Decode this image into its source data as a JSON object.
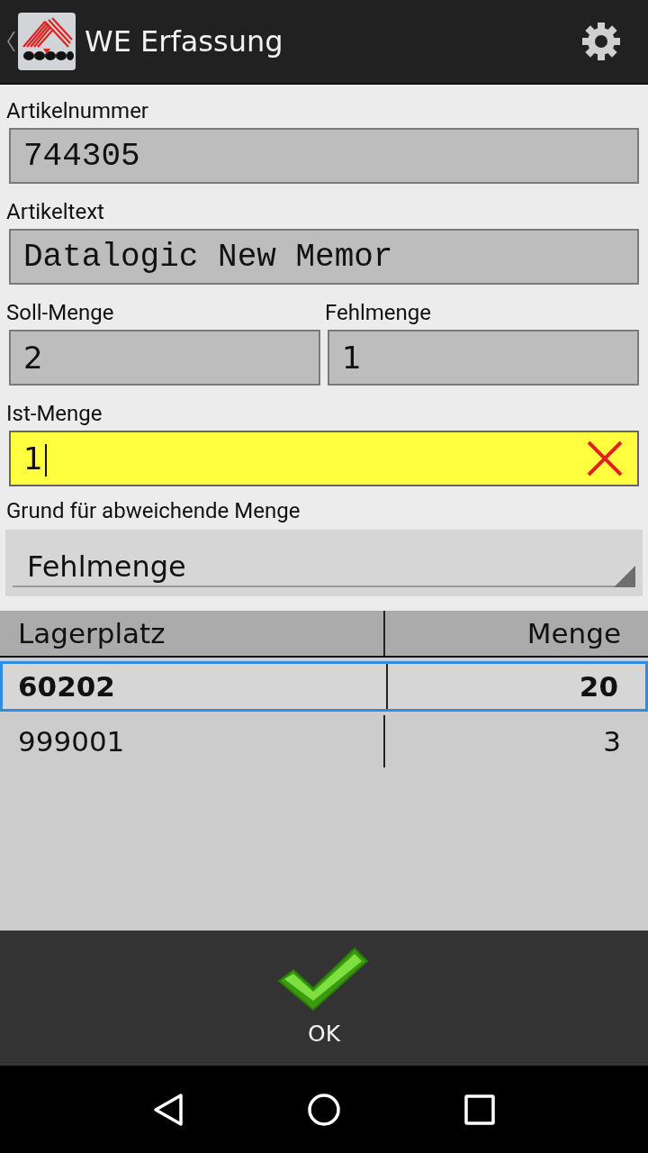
{
  "app_bar": {
    "title": "WE Erfassung"
  },
  "fields": [
    {
      "label": "Artikelnummer",
      "value": "744305",
      "kind": "mono",
      "focused": false
    },
    {
      "label": "Artikeltext",
      "value": "Datalogic New Memor",
      "kind": "mono",
      "focused": false
    }
  ],
  "field_pair": [
    {
      "label": "Soll-Menge",
      "value": "2",
      "kind": "text",
      "focused": false
    },
    {
      "label": "Fehlmenge",
      "value": "1",
      "kind": "text",
      "focused": false
    }
  ],
  "quantity": {
    "label": "Ist-Menge",
    "value": "1",
    "kind": "text",
    "focused": true
  },
  "reason": {
    "label": "Grund für abweichende Menge",
    "value": "Fehlmenge"
  },
  "table": {
    "columns": [
      "Lagerplatz",
      "Menge"
    ],
    "rows": [
      {
        "cells": [
          "60202",
          "20"
        ],
        "selected": true
      },
      {
        "cells": [
          "999001",
          "3"
        ],
        "selected": false
      }
    ]
  },
  "ok_button": {
    "label": "OK"
  }
}
